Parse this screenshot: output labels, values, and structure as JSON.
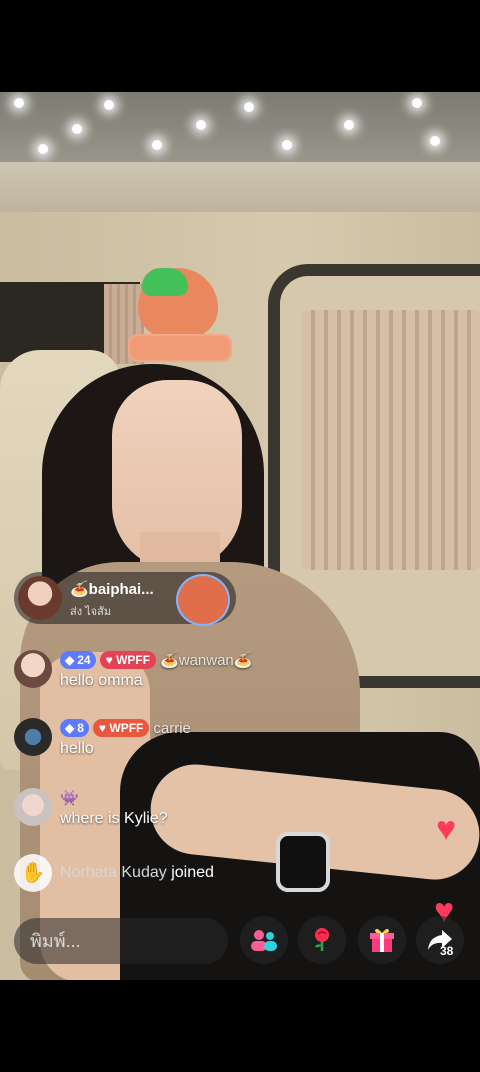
{
  "pinned": {
    "name": "🍝baiphai...",
    "sub": "ส่ง ไจสัม"
  },
  "messages": [
    {
      "level": "24",
      "fan": "WPFF",
      "user": "🍝wanwan🍝",
      "text": "hello omma"
    },
    {
      "level": "8",
      "fan": "WPFF",
      "user": "carrie",
      "text": "hello"
    },
    {
      "user": "",
      "text": "where is Kylie?"
    }
  ],
  "joined": {
    "user": "Norhata Kuday",
    "action": "joined"
  },
  "input": {
    "placeholder": "พิมพ์..."
  },
  "share": {
    "count": "38"
  },
  "colors": {
    "accent": "#ff3a5c",
    "level_badge": "#5e7bff",
    "fan_badge": "#e24455"
  },
  "icons": [
    "guest-icon",
    "rose-icon",
    "gift-icon",
    "share-icon",
    "wave-icon",
    "heart-icon"
  ]
}
